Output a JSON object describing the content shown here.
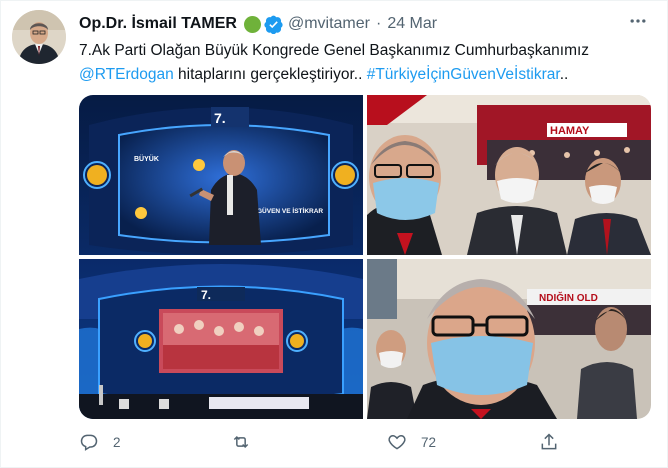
{
  "author": {
    "name": "Op.Dr. İsmail TAMER",
    "handle": "@mvitamer",
    "date": "24 Mar"
  },
  "tweet": {
    "line1": "7.Ak Parti Olağan Büyük Kongrede Genel Başkanımız Cumhurbaşkanımız",
    "mention": "@RTErdogan",
    "text_mid": " hitaplarını gerçekleştiriyor.. ",
    "hashtag": "#TürkiyeİçinGüvenVeİstikrar",
    "text_end": ".."
  },
  "photos": {
    "photo1_logo": "7.",
    "photo1_screen_left": "BÜYÜK",
    "photo1_screen_right": "GÜVEN VE İSTİKRAR",
    "photo2_banner": "HAMAY",
    "photo3_logo": "7.",
    "photo4_banner": "NDIĞIN OLD"
  },
  "actions": {
    "replies": "2",
    "retweets": "",
    "likes": "72"
  },
  "colors": {
    "link": "#1d9bf0",
    "muted": "#536471",
    "verified": "#1d9bf0",
    "status_dot": "#6fb23a"
  }
}
